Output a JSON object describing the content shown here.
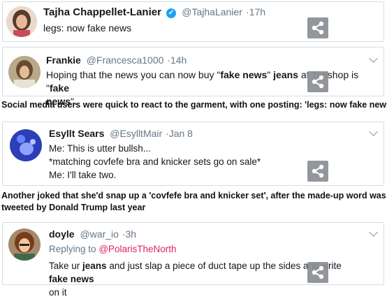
{
  "tweets": [
    {
      "name": "Tajha Chappellet-Lanier",
      "handle": "@TajhaLanier",
      "time": "·17h",
      "text": "legs: now fake news"
    },
    {
      "name": "Frankie",
      "handle": "@Francesca1000",
      "time": "·14h",
      "parts": [
        "Hoping that the news you can now buy \"",
        "fake news",
        "\" ",
        "jeans",
        " at Topshop is \"",
        "fake",
        "news",
        "\"."
      ]
    },
    {
      "name": "Esyllt Sears",
      "handle": "@EsylltMair",
      "time": "·Jan 8",
      "lines": [
        "Me: This is utter bullsh...",
        "*matching covfefe bra and knicker sets go on sale*",
        "Me: I'll take two."
      ]
    },
    {
      "name": "doyle",
      "handle": "@war_io",
      "time": "·3h",
      "replying_label": "Replying to",
      "replying_to": "@PolarisTheNorth",
      "parts": [
        "Take ur ",
        "jeans",
        " and just slap a piece of duct tape up the sides and write ",
        "fake news",
        "on it"
      ]
    }
  ],
  "captions": {
    "first": "Social media users were quick to react to the garment, with one posting: 'legs: now fake news'",
    "second_line1": "Another joked that she'd snap up a 'covfefe bra and knicker set', after the made-up word was",
    "second_line2": "tweeted by Donald Trump last year"
  },
  "icons": {
    "share": "share-icon",
    "verified": "verified-badge-icon",
    "menu": "chevron-down-icon"
  },
  "colors": {
    "verified": "#1da1f2",
    "reply_link": "#e0245e",
    "share_bg": "#8a8f94"
  }
}
